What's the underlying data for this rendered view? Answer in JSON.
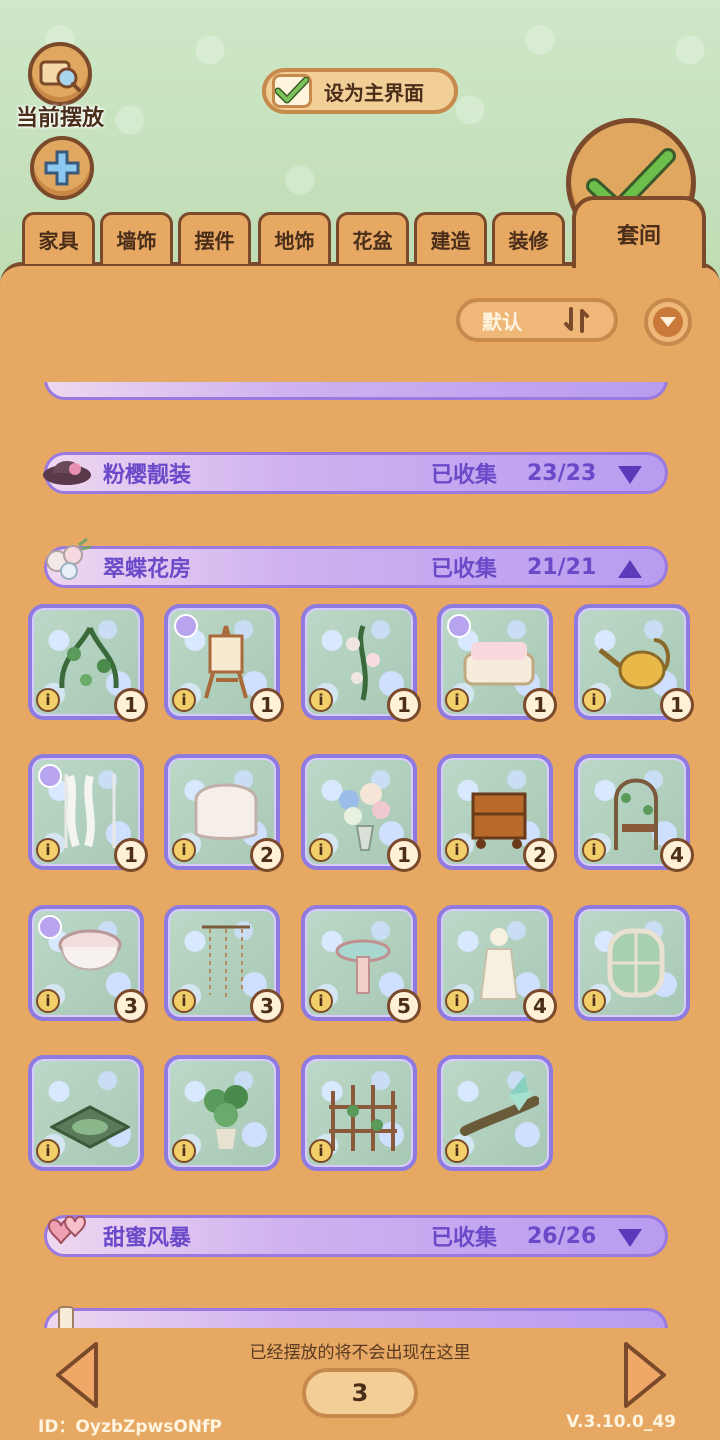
{
  "header": {
    "current_placed_label": "当前摆放",
    "set_main_label": "设为主界面"
  },
  "tabs": [
    {
      "label": "家具"
    },
    {
      "label": "墙饰"
    },
    {
      "label": "摆件"
    },
    {
      "label": "地饰"
    },
    {
      "label": "花盆"
    },
    {
      "label": "建造"
    },
    {
      "label": "装修"
    }
  ],
  "active_tab": {
    "label": "套间"
  },
  "sort": {
    "label": "默认"
  },
  "categories": [
    {
      "name": "粉樱靓装",
      "collected_label": "已收集",
      "count": "23/23",
      "expanded": false
    },
    {
      "name": "翠蝶花房",
      "collected_label": "已收集",
      "count": "21/21",
      "expanded": true
    },
    {
      "name": "甜蜜风暴",
      "collected_label": "已收集",
      "count": "26/26",
      "expanded": false
    }
  ],
  "items": [
    {
      "qty": "1",
      "suite": false,
      "art": "vine-icon"
    },
    {
      "qty": "1",
      "suite": true,
      "art": "easel-icon"
    },
    {
      "qty": "1",
      "suite": false,
      "art": "rose-vine-icon"
    },
    {
      "qty": "1",
      "suite": true,
      "art": "sofa-icon"
    },
    {
      "qty": "1",
      "suite": false,
      "art": "watering-can-icon"
    },
    {
      "qty": "1",
      "suite": true,
      "art": "curtain-icon"
    },
    {
      "qty": "2",
      "suite": false,
      "art": "lace-table-icon"
    },
    {
      "qty": "1",
      "suite": false,
      "art": "flower-vase-icon"
    },
    {
      "qty": "2",
      "suite": false,
      "art": "tea-cart-icon"
    },
    {
      "qty": "4",
      "suite": false,
      "art": "arch-trellis-icon"
    },
    {
      "qty": "3",
      "suite": true,
      "art": "lace-stool-icon"
    },
    {
      "qty": "3",
      "suite": false,
      "art": "bead-curtain-icon"
    },
    {
      "qty": "5",
      "suite": false,
      "art": "birdbath-icon"
    },
    {
      "qty": "4",
      "suite": false,
      "art": "statue-icon"
    },
    {
      "qty": "",
      "suite": false,
      "art": "window-icon"
    },
    {
      "qty": "",
      "suite": false,
      "art": "pond-tile-icon"
    },
    {
      "qty": "",
      "suite": false,
      "art": "flower-pot-icon"
    },
    {
      "qty": "",
      "suite": false,
      "art": "fence-icon"
    },
    {
      "qty": "",
      "suite": false,
      "art": "butterfly-log-icon"
    }
  ],
  "footer": {
    "hint": "已经摆放的将不会出现在这里",
    "page": "3",
    "user_id": "ID：OyzbZpwsONfP",
    "version": "V.3.10.0_49"
  },
  "colors": {
    "panel": "#e6a862",
    "border": "#7a4a2a",
    "category_text": "#6a4ac8",
    "sky": "#c9e3bf"
  }
}
